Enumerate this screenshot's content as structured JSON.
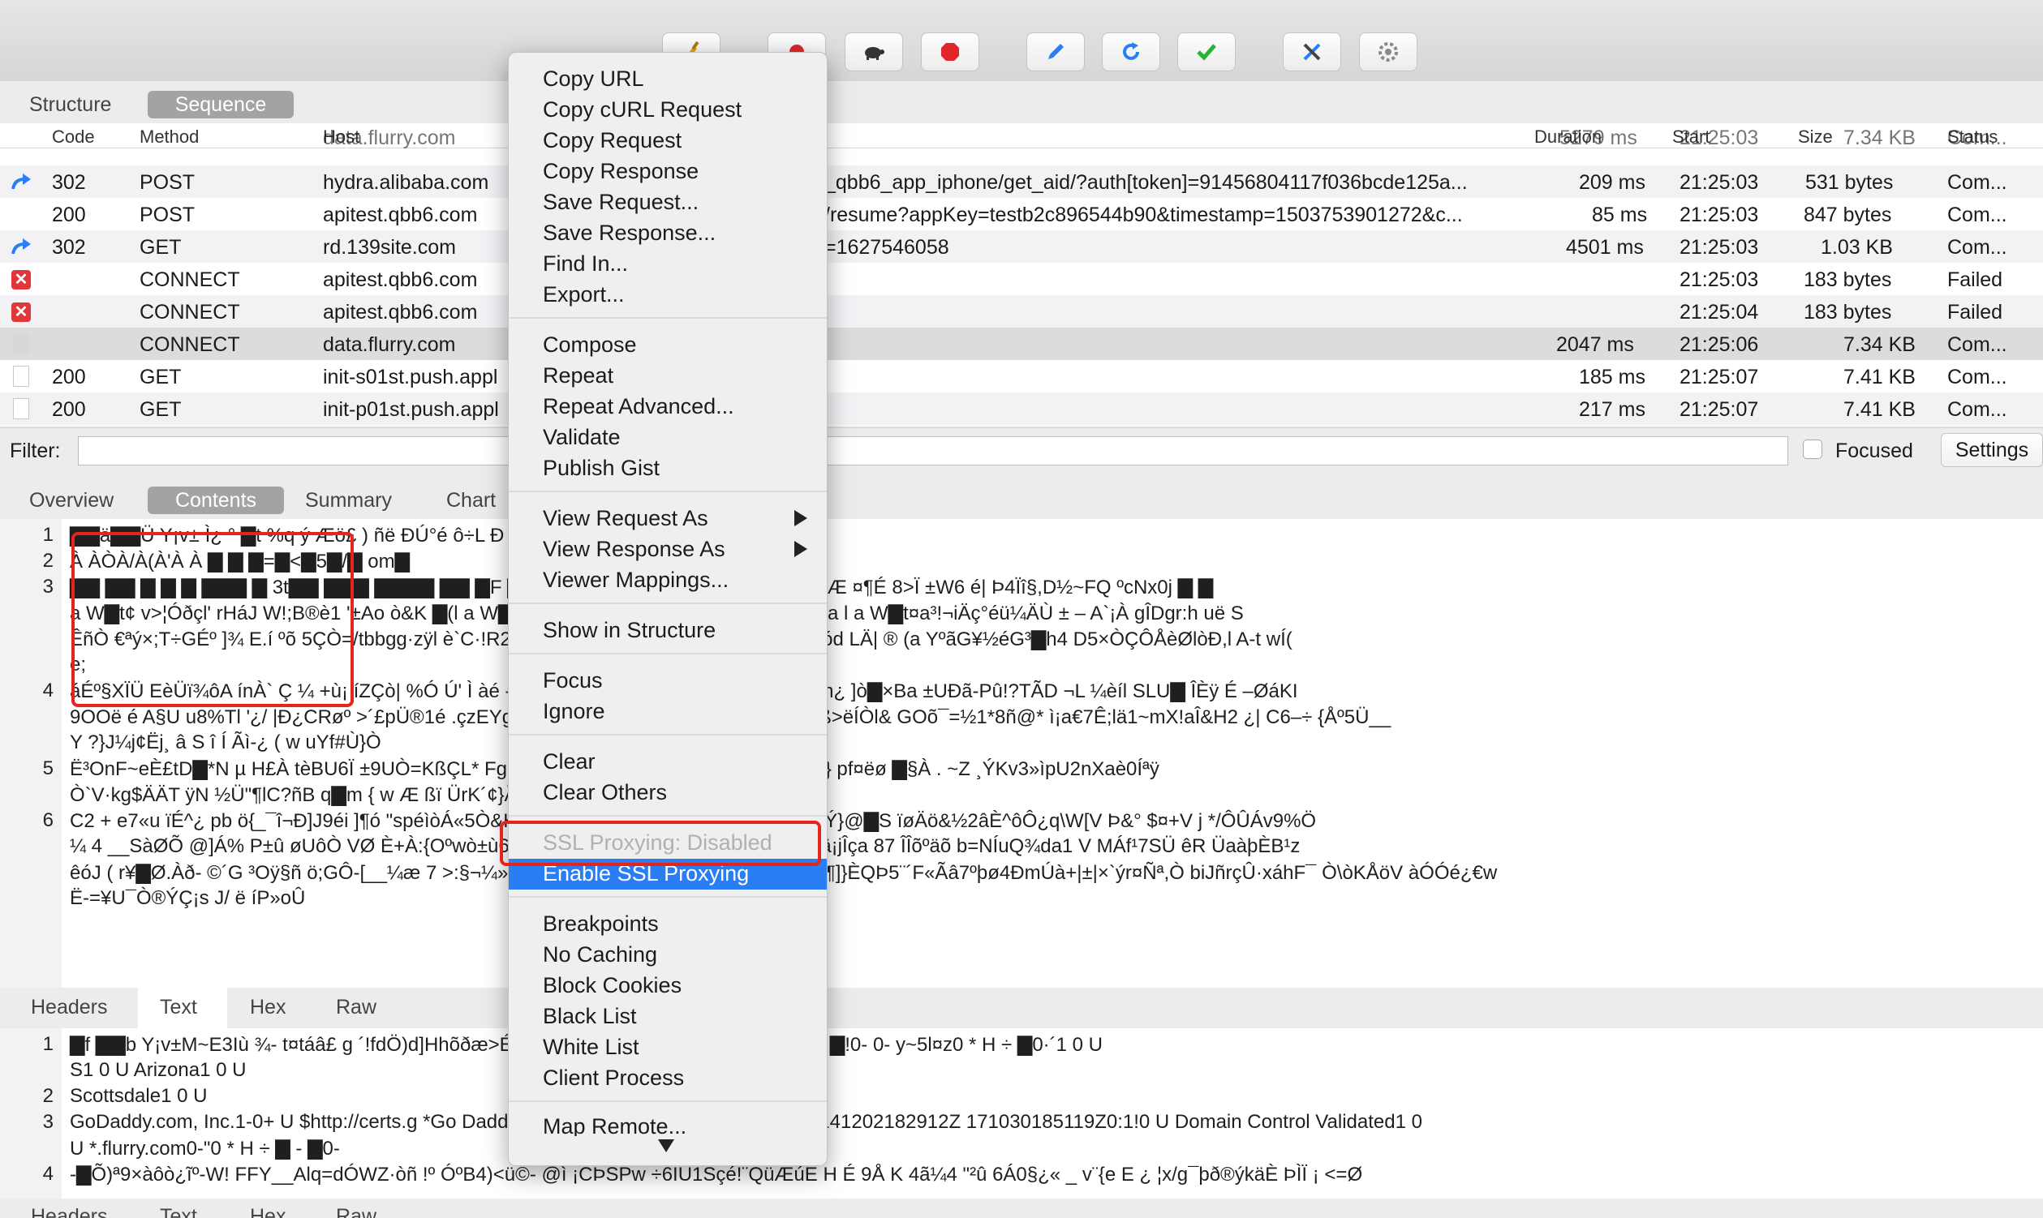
{
  "toolbar": {
    "buttons": [
      {
        "name": "broom-icon",
        "color": "#e0a30f"
      },
      {
        "name": "record-icon",
        "color": "#e0262a"
      },
      {
        "name": "turtle-throttle-icon",
        "color": "#333333"
      },
      {
        "name": "stop-breakpoint-icon",
        "color": "#e0262a"
      },
      {
        "name": "compose-pen-icon",
        "color": "#2a7ef4"
      },
      {
        "name": "repeat-refresh-icon",
        "color": "#2a7ef4"
      },
      {
        "name": "validate-check-icon",
        "color": "#2ab236"
      },
      {
        "name": "tools-icon",
        "color": "#2a7ef4"
      },
      {
        "name": "settings-gear-icon",
        "color": "#8a8a8a"
      }
    ]
  },
  "view_tabs": {
    "structure": "Structure",
    "sequence": "Sequence",
    "active": "Sequence"
  },
  "table": {
    "columns": {
      "code": "Code",
      "method": "Method",
      "host": "Host",
      "duration": "Duration",
      "start": "Start",
      "size": "Size",
      "status": "Status"
    },
    "partial_row": {
      "host": "data.flurry.com",
      "duration": "5279 ms",
      "start": "21:25:03",
      "size": "7.34 KB",
      "status": "Com..."
    },
    "rows": [
      {
        "icon": "redirect-arrow-icon",
        "code": "302",
        "method": "POST",
        "host": "hydra.alibaba.com",
        "path": "_qbb6_app_iphone/get_aid/?auth[token]=91456804117f036bcde125a...",
        "duration": "209 ms",
        "start": "21:25:03",
        "size": "531 bytes",
        "status": "Com..."
      },
      {
        "icon": "none",
        "code": "200",
        "method": "POST",
        "host": "apitest.qbb6.com",
        "path": "/resume?appKey=testb2c896544b90&timestamp=1503753901272&c...",
        "duration": "85 ms",
        "start": "21:25:03",
        "size": "847 bytes",
        "status": "Com..."
      },
      {
        "icon": "redirect-arrow-icon",
        "code": "302",
        "method": "GET",
        "host": "rd.139site.com",
        "path": "=1627546058",
        "duration": "4501 ms",
        "start": "21:25:03",
        "size": "1.03 KB",
        "status": "Com..."
      },
      {
        "icon": "failed-x-icon",
        "code": "",
        "method": "CONNECT",
        "host": "apitest.qbb6.com",
        "path": "",
        "duration": "",
        "start": "21:25:03",
        "size": "183 bytes",
        "status": "Failed"
      },
      {
        "icon": "failed-x-icon",
        "code": "",
        "method": "CONNECT",
        "host": "apitest.qbb6.com",
        "path": "",
        "duration": "",
        "start": "21:25:04",
        "size": "183 bytes",
        "status": "Failed"
      },
      {
        "icon": "lock-icon",
        "code": "",
        "method": "CONNECT",
        "host": "data.flurry.com",
        "path": "",
        "duration": "2047 ms",
        "start": "21:25:06",
        "size": "7.34 KB",
        "status": "Com..."
      },
      {
        "icon": "document-icon",
        "code": "200",
        "method": "GET",
        "host": "init-s01st.push.appl",
        "path": "",
        "duration": "185 ms",
        "start": "21:25:07",
        "size": "7.41 KB",
        "status": "Com..."
      },
      {
        "icon": "document-icon",
        "code": "200",
        "method": "GET",
        "host": "init-p01st.push.appl",
        "path": "",
        "duration": "217 ms",
        "start": "21:25:07",
        "size": "7.41 KB",
        "status": "Com..."
      }
    ]
  },
  "filter": {
    "label": "Filter:",
    "value": "",
    "focused_label": "Focused",
    "settings_label": "Settings"
  },
  "detail_tabs": {
    "overview": "Overview",
    "contents": "Contents",
    "summary": "Summary",
    "chart": "Chart",
    "active": "Contents"
  },
  "request_body": {
    "line_numbers": [
      "1",
      "2",
      "3",
      "4",
      "5",
      "6"
    ],
    "lines": [
      "▇▇ä▇▇Ü  Y¡v±  Ì¿     °  ▇t  %q ý  Æö£ )        ñë                          ÐÚ°é ô÷L Ð ▇&▇ÿÀ,À+À$À#À",
      "À        ÀÒÀ/À(À'À À  ▇     ▇  ▇=▇<▇5▇/▇                                         om▇",
      "▇▇ ▇▇ ▇ ▇ ▇ ▇▇▇ ▇            3t▇▇                          ▇▇▇ ▇▇▇▇ ▇▇      ▇F ▇▇BA f:8À__§»R¨üxtâ    M ^ÀÎ Yy¨    A    HÆ     ¤¶É     8>Ï    ±W6 é|     Þ4Ïî§,D½~FQ    ºcNx0j     ▇     ▇",
      " a   W▇t¢    v>¦Óðçl'    rHáJ  W!;B®è1     '±Ao                     ò&K  ▇(l a    W▇t£b5*Þù        åNHdâù     Ç{Cé ux¡ø¬ØÂ     v Ba     l a     W▇t¤a³!¬iÄç°éü¼ÄÙ    ±   –     A`¡À    gÎDgr:h uë     S",
      "ÊñÒ €ªý×;T÷GÉº ]¾ E.í ºõ 5ÇÒ=/tbbgg·zÿl                  è`C·!R2Uä     __    TªP        MüäèSÂ      F0      ô ä    !Yqh       =j>     ód         LÄ|    ®    (a    YºãG¥½éG³▇h4  D5×ÒÇÔÅèØlòÐ,l A-t     wÍ(",
      "   e;"
    ]
  },
  "request_body_2": {
    "lines": [
      "áÉº§XÏÜ     EèÜï¾ôA    ínÀ`  Ç ¼ +ù¡ íZÇò| %Ó                         Ú'  Ì àé    -l a    W▇t¥@ô*    Û»÷       )K q    ÿ«ÎÀèD Î/ªô    ·n¿  ]ò▇×Ba     ±UÐã-Pû!?TÃD ¬L ¼èíl SLU▇        ÎÈÿ            É –ØáKI",
      "9OOë é A§U    u8%Tl '¿/     |Ð¿CRøº  >´£pÜ®1é                           .çzEYgq     þå ▇     E1P±¿#' 4ÍBlâ     ]¬¶AÛy8M ¿       ß>ëÍÒl&    GOõ¯=½1*8ñ@*    ì¡a€7Ê;lä1~mX!aÎ&H2 ¿|    C6–÷    {Åº5Ü__",
      " Y   ?}J¼j¢Ëj¸     â S î   Í Ãì-¿    ( w    uYf#Ù}Ò",
      "Ë³OnF~eÈ£tD▇*N      µ H£À          tèBU6Ï                          ±9UÒ=KßÇL*    Fg               ]Wâeà µ\" ÜXE8´- ^·6    j¥¹,    ~           #     () Ýè     Ê} pf¤ëø     ▇§À    .  ~Z     ¸ÝKv3»ìpU2nXaè0Íªÿ",
      "Ò`V·kg$ÄÄT       ÿN ½Ü\"¶lC?ñB q▇m   {   w                           Æ      ßï ÜrK´¢}Ã<Îì__     ñÖgÈT¼~'<½ 7àZ J±",
      "    C2       +    e7«u ïÉ^¿      pb     ö{_¯î¬Ð]J9éi                 ]¶ó      \"spéìòÁ«5Ò&H®±1]Òg,ï òa   N¤     }a¤ÂQ¦\\G0ù`ïHÓo    ÌÝ}@▇S    ïøÄö&½2âÈ^ôÔ¿q\\W[V     Þ&° $¤+V    j      */ÔÛÁv9%Ö",
      " ¼ 4  __SàØÕ    @]Á%    P±û         øUôÒ    VØ                        È+À:{Oºwò±ù6Ð     h'):Bõ f¹2K ZYî =ª c¹c    { ö#øüÆlñYä¡jÎça 87     ÎÎõºäõ          b=NÍuQ¾da1    V     MÁf¹7SÜ êR ÜaàþÈB¹z",
      "êóJ ( r¥▇Ø.Àð- ©´G ³Oÿ§ñ ö;GÔ-[__¼æ  7                          >:§¬¼» ô__óg&nnanÎ.ALê€Zæhðq Ý    Èlm¶    z¶]}ÈQÞ5¨´F«Ãâ7ºþø4ÐmÚà+|±|×`ýr¤Ñª,Ò    biJñrçÛ·xáhF¯ Ò\\òKÅöV àÓÓé¿€w",
      "Ë-=¥U¯Ò®ÝÇ¡s   J/  ë    íP»oÛ"
    ]
  },
  "response_tabs": {
    "headers": "Headers",
    "text": "Text",
    "hex": "Hex",
    "raw": "Raw",
    "active": "Text"
  },
  "response_body": {
    "line_numbers": [
      "1",
      "2",
      "3",
      "4"
    ],
    "lines": [
      "   ▇f  ▇▇b  Y¡v±M~E3Iù    ¾-          t¤táâ£ g                             ´!fdÖ)d]Hhõðæ>É      À/▇▇  ÿ▇▇▇▇  ▇  ▇ 3t▇http/1.1            ▇         ▇        ▇!0- 0-             y~5l¤z0           *    H     ÷  ▇0·´1 0          U",
      "S1 0    U    Arizona1 0    U",
      "Scottsdale1 0    U",
      "  GoDaddy.com, Inc.1-0+  U    $http://certs.g                                              *Go Daddy Secure Certificate Authority - G20  141202182912Z 171030185119Z0:1!0     U     Domain Control Validated1 0",
      "U    *.flurry.com0-\"0 *    H    ÷ ▇ - ▇0-",
      " -▇Õ)ª9×àôò¿ĩº-W!     FFY__Alq=dÓWZ·òñ !º    ÓºB4)<ü©-     @ì ¡CÞSPw    ÷6ÎU1Sçé!¨QüÆúË H     É     9Å      K 4ã¼4 \"²û 6Á0§¿«  _       v¨{e E         ¿        ¦x/g¯þð®ýkäÈ  ÞÌÏ        ¡  <=Ø"
    ]
  },
  "bottom_tabs": {
    "headers": "Headers",
    "text": "Text",
    "hex": "Hex",
    "raw": "Raw"
  },
  "context_menu": {
    "group1": [
      "Copy URL",
      "Copy cURL Request",
      "Copy Request",
      "Copy Response",
      "Save Request...",
      "Save Response...",
      "Find In...",
      "Export..."
    ],
    "group2": [
      "Compose",
      "Repeat",
      "Repeat Advanced...",
      "Validate",
      "Publish Gist"
    ],
    "group3": [
      "View Request As",
      "View Response As",
      "Viewer Mappings..."
    ],
    "group4": [
      "Show in Structure"
    ],
    "group5": [
      "Focus",
      "Ignore"
    ],
    "group6": [
      "Clear",
      "Clear Others"
    ],
    "ssl_disabled": "SSL Proxying: Disabled",
    "enable_ssl": "Enable SSL Proxying",
    "group8": [
      "Breakpoints",
      "No Caching",
      "Block Cookies",
      "Black List",
      "White List",
      "Client Process"
    ],
    "partial_item": "Map Remote...",
    "highlight_color": "#2a7ef4",
    "annotation_color": "#e8231d"
  }
}
